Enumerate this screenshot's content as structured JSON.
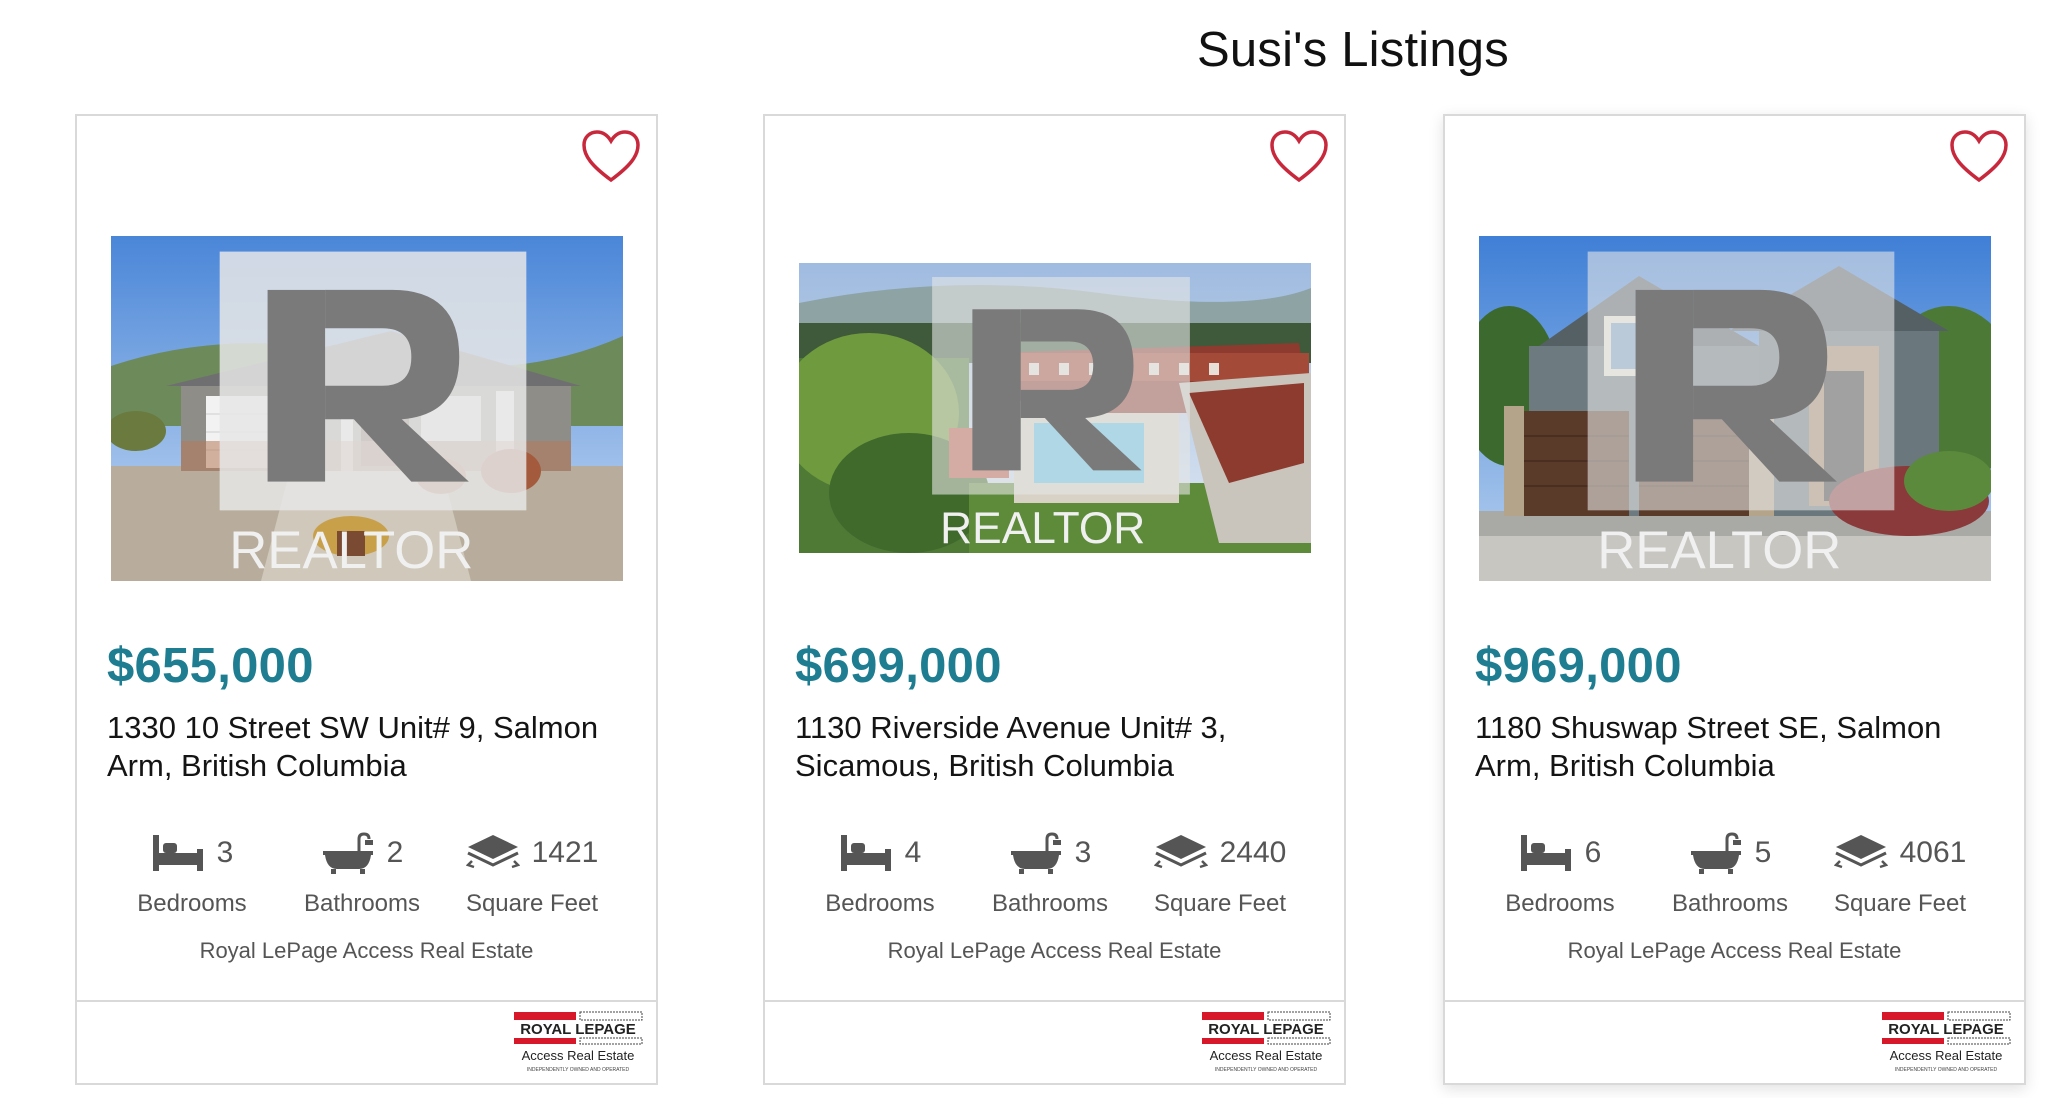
{
  "page": {
    "title": "Susi's Listings"
  },
  "icons": {
    "favorite": "heart-outline-icon",
    "bedrooms": "bed-icon",
    "bathrooms": "bathtub-icon",
    "square_feet": "area-icon",
    "realtor": "realtor-logo",
    "brokerage_logo": "royal-lepage-logo"
  },
  "colors": {
    "price": "#1e7d91",
    "heart": "#c8283c",
    "stat": "#555555",
    "border": "#d9d9d9"
  },
  "listings": [
    {
      "price": "$655,000",
      "address": "1330 10 Street SW Unit# 9, Salmon Arm, British Columbia",
      "bedrooms": "3",
      "bedrooms_label": "Bedrooms",
      "bathrooms": "2",
      "bathrooms_label": "Bathrooms",
      "sqft": "1421",
      "sqft_label": "Square Feet",
      "brokerage": "Royal LePage Access Real Estate",
      "realtor_text": "REALTOR",
      "logo_line1": "ROYAL LEPAGE",
      "logo_line2": "Access Real Estate",
      "logo_line3": "INDEPENDENTLY OWNED AND OPERATED"
    },
    {
      "price": "$699,000",
      "address": "1130 Riverside Avenue Unit# 3, Sicamous, British Columbia",
      "bedrooms": "4",
      "bedrooms_label": "Bedrooms",
      "bathrooms": "3",
      "bathrooms_label": "Bathrooms",
      "sqft": "2440",
      "sqft_label": "Square Feet",
      "brokerage": "Royal LePage Access Real Estate",
      "realtor_text": "REALTOR",
      "logo_line1": "ROYAL LEPAGE",
      "logo_line2": "Access Real Estate",
      "logo_line3": "INDEPENDENTLY OWNED AND OPERATED"
    },
    {
      "price": "$969,000",
      "address": "1180 Shuswap Street SE, Salmon Arm, British Columbia",
      "bedrooms": "6",
      "bedrooms_label": "Bedrooms",
      "bathrooms": "5",
      "bathrooms_label": "Bathrooms",
      "sqft": "4061",
      "sqft_label": "Square Feet",
      "brokerage": "Royal LePage Access Real Estate",
      "realtor_text": "REALTOR",
      "logo_line1": "ROYAL LEPAGE",
      "logo_line2": "Access Real Estate",
      "logo_line3": "INDEPENDENTLY OWNED AND OPERATED"
    }
  ]
}
